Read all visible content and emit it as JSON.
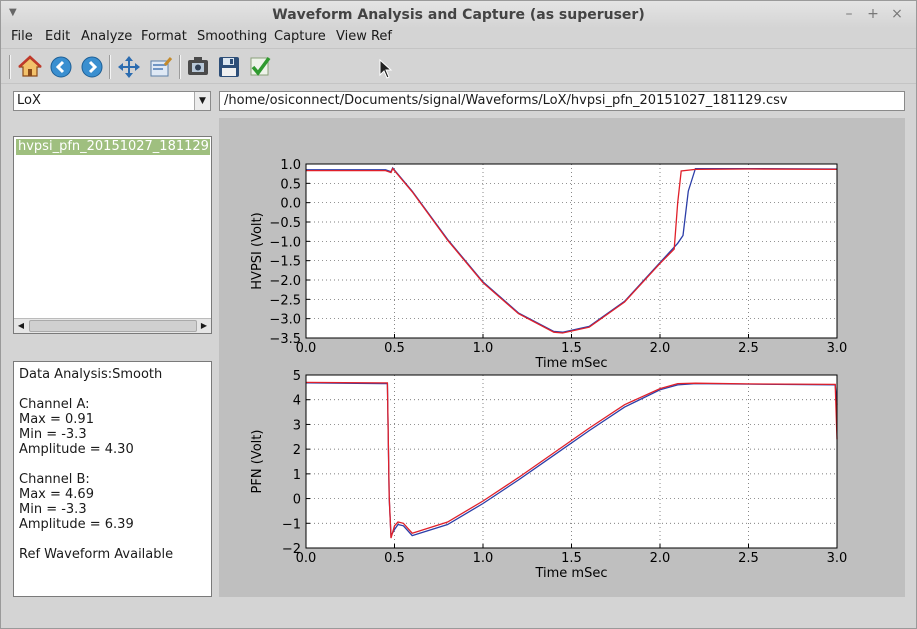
{
  "window": {
    "title": "Waveform Analysis and Capture (as superuser)",
    "buttons": [
      "–",
      "+",
      "×"
    ]
  },
  "menu": [
    "File",
    "Edit",
    "Analyze",
    "Format",
    "Smoothing",
    "Capture",
    "View Ref"
  ],
  "toolbar": {
    "icons": [
      "home-icon",
      "back-icon",
      "forward-icon",
      "pan-icon",
      "configure-icon",
      "capture-icon",
      "save-icon",
      "apply-check-icon"
    ]
  },
  "source_select": {
    "value": "LoX"
  },
  "file_path": "/home/osiconnect/Documents/signal/Waveforms/LoX/hvpsi_pfn_20151027_181129.csv",
  "file_list": {
    "items": [
      "hvpsi_pfn_20151027_181129.csv"
    ],
    "selected": 0
  },
  "analysis": {
    "lines": [
      "Data Analysis:Smooth",
      "",
      "Channel A:",
      "Max = 0.91",
      "Min = -3.3",
      "Amplitude = 4.30",
      "",
      "Channel B:",
      "Max = 4.69",
      "Min = -3.3",
      "Amplitude = 6.39",
      "",
      "Ref Waveform Available"
    ]
  },
  "colors": {
    "series_blue": "#2c3ea8",
    "series_red": "#e0202a",
    "selection": "#9fbf7f"
  },
  "chart_data": [
    {
      "type": "line",
      "xlabel": "Time mSec",
      "ylabel": "HVPSI (Volt)",
      "xlim": [
        0.0,
        3.0
      ],
      "ylim": [
        -3.5,
        1.0
      ],
      "xticks": [
        "0.0",
        "0.5",
        "1.0",
        "1.5",
        "2.0",
        "2.5",
        "3.0"
      ],
      "yticks": [
        "1.0",
        "0.5",
        "0.0",
        "−0.5",
        "−1.0",
        "−1.5",
        "−2.0",
        "−2.5",
        "−3.0",
        "−3.5"
      ],
      "grid": true,
      "series": [
        {
          "color": "#2c3ea8",
          "x": [
            0.0,
            0.45,
            0.48,
            0.49,
            0.6,
            0.8,
            1.0,
            1.2,
            1.4,
            1.45,
            1.6,
            1.8,
            2.0,
            2.1,
            2.13,
            2.16,
            2.2,
            2.5,
            3.0
          ],
          "y": [
            0.85,
            0.85,
            0.8,
            0.9,
            0.3,
            -0.95,
            -2.05,
            -2.85,
            -3.33,
            -3.35,
            -3.2,
            -2.55,
            -1.55,
            -1.05,
            -0.85,
            0.3,
            0.88,
            0.88,
            0.87
          ]
        },
        {
          "color": "#e0202a",
          "x": [
            0.0,
            0.45,
            0.48,
            0.49,
            0.6,
            0.8,
            1.0,
            1.2,
            1.4,
            1.45,
            1.6,
            1.8,
            2.0,
            2.08,
            2.1,
            2.12,
            2.2,
            2.5,
            3.0
          ],
          "y": [
            0.83,
            0.83,
            0.78,
            0.88,
            0.28,
            -0.97,
            -2.07,
            -2.87,
            -3.35,
            -3.37,
            -3.22,
            -2.57,
            -1.57,
            -1.2,
            0.0,
            0.82,
            0.86,
            0.87,
            0.86
          ]
        }
      ]
    },
    {
      "type": "line",
      "xlabel": "Time mSec",
      "ylabel": "PFN (Volt)",
      "xlim": [
        0.0,
        3.0
      ],
      "ylim": [
        -2,
        5
      ],
      "xticks": [
        "0.0",
        "0.5",
        "1.0",
        "1.5",
        "2.0",
        "2.5",
        "3.0"
      ],
      "yticks": [
        "5",
        "4",
        "3",
        "2",
        "1",
        "0",
        "−1",
        "−2"
      ],
      "grid": true,
      "series": [
        {
          "color": "#2c3ea8",
          "x": [
            0.0,
            0.46,
            0.47,
            0.48,
            0.5,
            0.52,
            0.55,
            0.6,
            0.8,
            1.0,
            1.2,
            1.4,
            1.6,
            1.8,
            2.0,
            2.1,
            2.2,
            2.5,
            2.99,
            3.0
          ],
          "y": [
            4.68,
            4.65,
            0.0,
            -1.5,
            -1.25,
            -1.05,
            -1.1,
            -1.5,
            -1.05,
            -0.2,
            0.75,
            1.75,
            2.75,
            3.7,
            4.4,
            4.6,
            4.65,
            4.63,
            4.6,
            3.8
          ]
        },
        {
          "color": "#e0202a",
          "x": [
            0.0,
            0.46,
            0.47,
            0.48,
            0.5,
            0.52,
            0.55,
            0.6,
            0.8,
            1.0,
            1.2,
            1.4,
            1.6,
            1.8,
            2.0,
            2.1,
            2.2,
            2.5,
            2.99,
            3.0
          ],
          "y": [
            4.7,
            4.68,
            0.1,
            -1.6,
            -1.1,
            -0.95,
            -1.0,
            -1.4,
            -0.95,
            -0.1,
            0.85,
            1.85,
            2.85,
            3.8,
            4.45,
            4.65,
            4.67,
            4.64,
            4.62,
            2.4
          ]
        }
      ]
    }
  ]
}
